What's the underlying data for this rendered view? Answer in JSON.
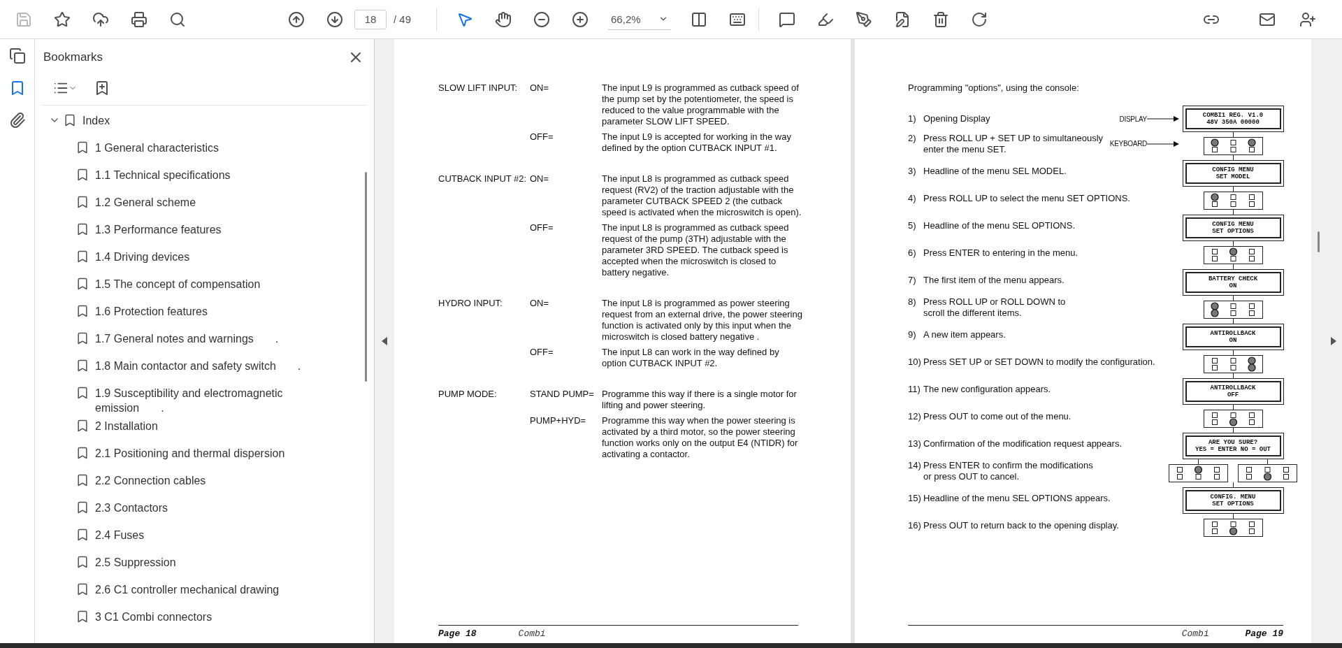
{
  "toolbar": {
    "save": {
      "disabled": true
    },
    "page_input": "18",
    "page_total": "/ 49",
    "zoom": "66,2%",
    "tools": [
      {
        "kind": "select",
        "selected": true
      },
      {
        "kind": "hand",
        "selected": false
      }
    ]
  },
  "rail": [
    {
      "kind": "pages",
      "selected": false
    },
    {
      "kind": "bookmarks",
      "selected": true
    },
    {
      "kind": "attachments",
      "selected": false
    }
  ],
  "bookmarks": {
    "title": "Bookmarks",
    "items": [
      {
        "label": "Index",
        "expanded": true,
        "children": [
          {
            "label": "1 General characteristics"
          },
          {
            "label": "1.1 Technical specifications"
          },
          {
            "label": "1.2 General scheme"
          },
          {
            "label": "1.3 Performance features"
          },
          {
            "label": "1.4 Driving devices"
          },
          {
            "label": "1.5 The concept of compensation"
          },
          {
            "label": "1.6 Protection features"
          },
          {
            "label": "1.7 General notes and warnings       ."
          },
          {
            "label": "1.8 Main contactor and safety switch       ."
          },
          {
            "label": "1.9 Susceptibility and electromagnetic emission       ."
          },
          {
            "label": "2 Installation"
          },
          {
            "label": "2.1 Positioning and thermal dispersion"
          },
          {
            "label": "2.2 Connection cables"
          },
          {
            "label": "2.3 Contactors"
          },
          {
            "label": "2.4 Fuses"
          },
          {
            "label": "2.5 Suppression"
          },
          {
            "label": "2.6 C1 controller mechanical drawing"
          },
          {
            "label": "3 C1 Combi connectors"
          }
        ]
      }
    ]
  },
  "left_page": {
    "sections": [
      {
        "label": "SLOW LIFT INPUT:",
        "options": [
          {
            "key": "ON=",
            "text": "The input L9 is programmed as cutback speed of the pump set by the potentiometer, the speed is reduced to the value programmable with the parameter SLOW LIFT SPEED."
          },
          {
            "key": "OFF=",
            "text": "The input L9 is accepted for working in the way defined by the option CUTBACK INPUT #1."
          }
        ]
      },
      {
        "label": "CUTBACK INPUT #2:",
        "options": [
          {
            "key": "ON=",
            "text": "The input L8 is programmed as cutback speed request (RV2) of the traction adjustable with the parameter CUTBACK SPEED 2 (the cutback speed is activated when the microswitch is open)."
          },
          {
            "key": "OFF=",
            "text": "The input L8 is programmed as cutback speed request of the pump (3TH) adjustable with the parameter 3RD SPEED. The cutback speed is accepted when the microswitch is closed to battery negative."
          }
        ]
      },
      {
        "label": "HYDRO INPUT:",
        "options": [
          {
            "key": "ON=",
            "text": "The input L8 is programmed as power steering request from an external drive, the power steering function is activated only by this input when the microswitch is closed battery negative ."
          },
          {
            "key": "OFF=",
            "text": "The input L8 can work in the way defined by option CUTBACK INPUT #2."
          }
        ]
      },
      {
        "label": "PUMP MODE:",
        "options": [
          {
            "key": "STAND PUMP=",
            "text": "Programme this way if there is a single motor for lifting and power steering."
          },
          {
            "key": "PUMP+HYD=",
            "text": "Programme this way when the power steering is activated by a third motor, so the power steering function works only on the output E4 (NTIDR) for activating a contactor."
          }
        ]
      }
    ],
    "footer": {
      "page": "Page 18",
      "title": "Combi"
    }
  },
  "right_page": {
    "intro": "Programming \"options\", using the console:",
    "steps": [
      {
        "number": "1)",
        "lines": [
          "Opening Display"
        ],
        "diagrams": [
          {
            "kind": "display",
            "label": "DISPLAY",
            "lines": [
              "COMBI1 REG. V1.0",
              "48V 350A 00000"
            ]
          }
        ]
      },
      {
        "number": "2)",
        "lines": [
          "Press ROLL UP + SET UP to simultaneously",
          "enter the menu SET."
        ],
        "diagrams": [
          {
            "kind": "keypad",
            "label": "KEYBOARD",
            "pressed": [
              true,
              false,
              true,
              false,
              false,
              false
            ]
          }
        ]
      },
      {
        "number": "3)",
        "lines": [
          "Headline of the menu SEL MODEL."
        ],
        "diagrams": [
          {
            "kind": "display",
            "lines": [
              "CONFIG MENU",
              "SET MODEL"
            ]
          }
        ]
      },
      {
        "number": "4)",
        "lines": [
          "Press ROLL UP to select the menu SET OPTIONS."
        ],
        "diagrams": [
          {
            "kind": "keypad",
            "pressed": [
              true,
              false,
              false,
              false,
              false,
              false
            ]
          }
        ]
      },
      {
        "number": "5)",
        "lines": [
          "Headline of the menu SEL OPTIONS."
        ],
        "diagrams": [
          {
            "kind": "display",
            "lines": [
              "CONFIG MENU",
              "SET OPTIONS"
            ]
          }
        ]
      },
      {
        "number": "6)",
        "lines": [
          "Press ENTER to entering in the menu."
        ],
        "diagrams": [
          {
            "kind": "keypad",
            "pressed": [
              false,
              true,
              false,
              false,
              false,
              false
            ]
          }
        ]
      },
      {
        "number": "7)",
        "lines": [
          "The first item of the menu appears."
        ],
        "diagrams": [
          {
            "kind": "display",
            "lines": [
              "BATTERY CHECK",
              "ON"
            ]
          }
        ]
      },
      {
        "number": "8)",
        "lines": [
          "Press ROLL UP or ROLL DOWN to",
          "scroll the different items."
        ],
        "diagrams": [
          {
            "kind": "keypad",
            "pressed": [
              true,
              false,
              false,
              true,
              false,
              false
            ]
          }
        ]
      },
      {
        "number": "9)",
        "lines": [
          "A new item appears."
        ],
        "diagrams": [
          {
            "kind": "display",
            "lines": [
              "ANTIROLLBACK",
              "ON"
            ]
          }
        ]
      },
      {
        "number": "10)",
        "lines": [
          "Press SET UP or SET DOWN to modify the configuration."
        ],
        "diagrams": [
          {
            "kind": "keypad",
            "pressed": [
              false,
              false,
              true,
              false,
              false,
              true
            ]
          }
        ]
      },
      {
        "number": "11)",
        "lines": [
          "The new configuration appears."
        ],
        "diagrams": [
          {
            "kind": "display",
            "lines": [
              "ANTIROLLBACK",
              "OFF"
            ]
          }
        ]
      },
      {
        "number": "12)",
        "lines": [
          "Press OUT to come out of the menu."
        ],
        "diagrams": [
          {
            "kind": "keypad",
            "pressed": [
              false,
              false,
              false,
              false,
              true,
              false
            ]
          }
        ]
      },
      {
        "number": "13)",
        "lines": [
          "Confirmation of the modification request appears."
        ],
        "diagrams": [
          {
            "kind": "display",
            "lines": [
              "ARE YOU SURE?",
              "YES = ENTER NO = OUT"
            ]
          }
        ]
      },
      {
        "number": "14)",
        "lines": [
          "Press ENTER to confirm the modifications",
          "or press OUT to cancel."
        ],
        "diagrams": [
          {
            "kind": "keypad",
            "pressed": [
              false,
              true,
              false,
              false,
              false,
              false
            ]
          },
          {
            "kind": "keypad",
            "pressed": [
              false,
              false,
              false,
              false,
              true,
              false
            ]
          }
        ]
      },
      {
        "number": "15)",
        "lines": [
          "Headline of the menu SEL OPTIONS appears."
        ],
        "diagrams": [
          {
            "kind": "display",
            "lines": [
              "CONFIG. MENU",
              "SET OPTIONS"
            ]
          }
        ]
      },
      {
        "number": "16)",
        "lines": [
          "Press OUT to return back to the opening display."
        ],
        "diagrams": [
          {
            "kind": "keypad",
            "pressed": [
              false,
              false,
              false,
              false,
              true,
              false
            ]
          }
        ]
      }
    ],
    "footer": {
      "title": "Combi",
      "page": "Page 19"
    }
  }
}
